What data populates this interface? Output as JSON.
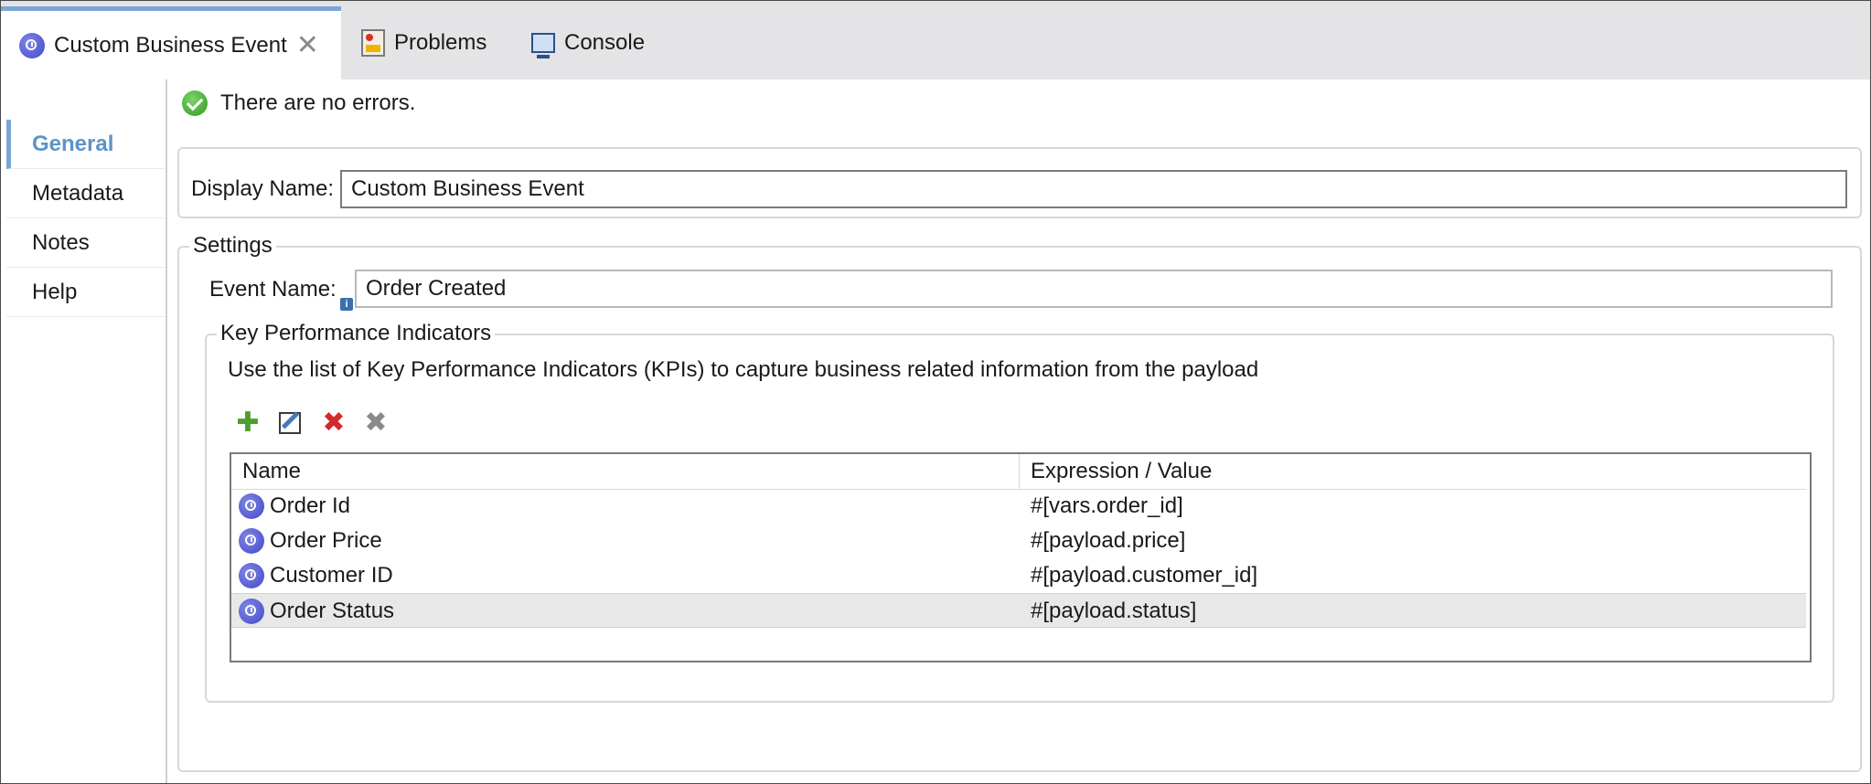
{
  "tabs": {
    "active": {
      "label": "Custom Business Event",
      "icon": "clock-icon"
    },
    "problems": {
      "label": "Problems",
      "icon": "problems-icon"
    },
    "console": {
      "label": "Console",
      "icon": "console-icon"
    },
    "close_glyph": "✕"
  },
  "sidebar": {
    "items": [
      {
        "label": "General",
        "active": true
      },
      {
        "label": "Metadata",
        "active": false
      },
      {
        "label": "Notes",
        "active": false
      },
      {
        "label": "Help",
        "active": false
      }
    ]
  },
  "status": {
    "text": "There are no errors.",
    "icon": "check-icon"
  },
  "display_name": {
    "label": "Display Name:",
    "value": "Custom Business Event"
  },
  "settings": {
    "legend": "Settings",
    "event_name": {
      "label": "Event Name:",
      "value": "Order Created",
      "info_glyph": "i"
    },
    "kpi": {
      "legend": "Key Performance Indicators",
      "description": "Use the list of Key Performance Indicators (KPIs) to capture business related information from the payload",
      "toolbar": {
        "add_glyph": "✚",
        "delete_glyph": "✖",
        "delete_all_glyph": "✖"
      },
      "table": {
        "columns": [
          "Name",
          "Expression / Value"
        ],
        "rows": [
          {
            "name": "Order Id",
            "expression": "#[vars.order_id]"
          },
          {
            "name": "Order Price",
            "expression": "#[payload.price]"
          },
          {
            "name": "Customer ID",
            "expression": "#[payload.customer_id]"
          },
          {
            "name": "Order Status",
            "expression": "#[payload.status]",
            "selected": true
          }
        ]
      }
    }
  },
  "colors": {
    "accent": "#7aa6d6",
    "active_nav_text": "#5c93c9",
    "tabbar_bg": "#e4e4e6",
    "selected_row_bg": "#e8e8e8"
  }
}
